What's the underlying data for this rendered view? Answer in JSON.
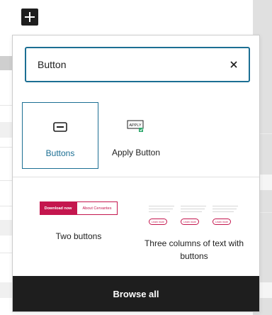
{
  "editor": {
    "inserter_toggle_icon": "plus-icon"
  },
  "inserter": {
    "search": {
      "value": "Button",
      "clear_icon": "close-icon"
    },
    "blocks": [
      {
        "label": "Buttons",
        "icon": "buttons-block-icon",
        "selected": true
      },
      {
        "label": "Apply Button",
        "icon": "apply-button-block-icon",
        "icon_text": "APPLY",
        "selected": false
      }
    ],
    "patterns": [
      {
        "label": "Two buttons",
        "preview": {
          "primary": "Download now",
          "secondary": "About Cervantes"
        }
      },
      {
        "label": "Three columns of text with buttons",
        "preview": {
          "button_text": "Learn more"
        }
      }
    ],
    "browse_all_label": "Browse all",
    "colors": {
      "accent": "#1c6f93",
      "dark": "#1e1e1e",
      "pattern_brand": "#c4164e"
    }
  }
}
